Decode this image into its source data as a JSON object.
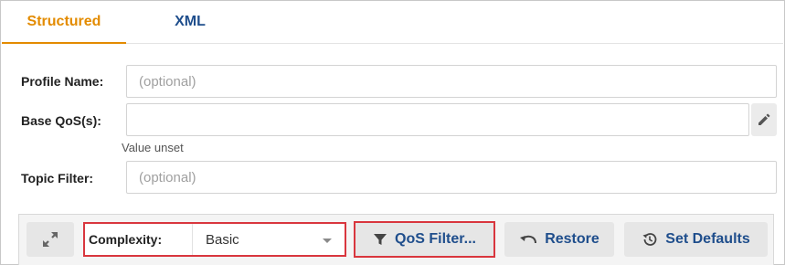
{
  "tabs": [
    {
      "label": "Structured",
      "active": true
    },
    {
      "label": "XML",
      "active": false
    }
  ],
  "form": {
    "profile_name": {
      "label": "Profile Name:",
      "value": "",
      "placeholder": "(optional)"
    },
    "base_qos": {
      "label": "Base QoS(s):",
      "value": "",
      "placeholder": "",
      "hint": "Value unset"
    },
    "topic_filter": {
      "label": "Topic Filter:",
      "value": "",
      "placeholder": "(optional)"
    }
  },
  "toolbar": {
    "complexity_label": "Complexity:",
    "complexity_value": "Basic",
    "qos_filter_label": "QoS Filter...",
    "restore_label": "Restore",
    "set_defaults_label": "Set Defaults"
  },
  "icons": {
    "edit": "pencil-icon",
    "expand": "expand-icon",
    "filter": "filter-icon",
    "restore": "undo-icon",
    "defaults": "history-icon"
  },
  "colors": {
    "active_tab": "#e38b00",
    "link_blue": "#1f4e8c",
    "highlight_red": "#d9363e"
  }
}
